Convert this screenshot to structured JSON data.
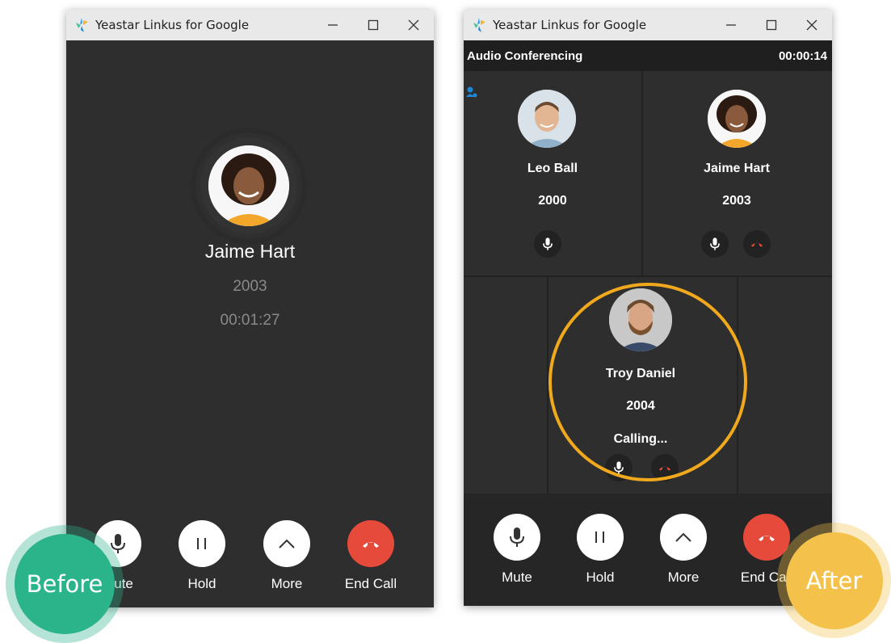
{
  "before_window": {
    "title": "Yeastar Linkus for Google",
    "contact_name": "Jaime Hart",
    "extension": "2003",
    "duration": "00:01:27",
    "controls": [
      {
        "label": "Mute",
        "icon": "mic-icon"
      },
      {
        "label": "Hold",
        "icon": "pause-icon"
      },
      {
        "label": "More",
        "icon": "chevron-up-icon"
      },
      {
        "label": "End Call",
        "icon": "hangup-icon"
      }
    ],
    "badge": "Before"
  },
  "after_window": {
    "title": "Yeastar Linkus for Google",
    "conference_label": "Audio Conferencing",
    "conference_timer": "00:00:14",
    "participants": [
      {
        "name": "Leo Ball",
        "extension": "2000",
        "status": ""
      },
      {
        "name": "Jaime Hart",
        "extension": "2003",
        "status": ""
      },
      {
        "name": "Troy Daniel",
        "extension": "2004",
        "status": "Calling..."
      }
    ],
    "controls": [
      {
        "label": "Mute",
        "icon": "mic-icon"
      },
      {
        "label": "Hold",
        "icon": "pause-icon"
      },
      {
        "label": "More",
        "icon": "chevron-up-icon"
      },
      {
        "label": "End Call",
        "icon": "hangup-icon"
      }
    ],
    "badge": "After"
  },
  "colors": {
    "window_bg": "#2e2e2e",
    "titlebar_bg": "#e9e9e9",
    "end_call_red": "#e64a3b",
    "highlight_orange": "#f0a91c",
    "before_badge": "#2bb38a",
    "after_badge": "#f4c24a"
  }
}
